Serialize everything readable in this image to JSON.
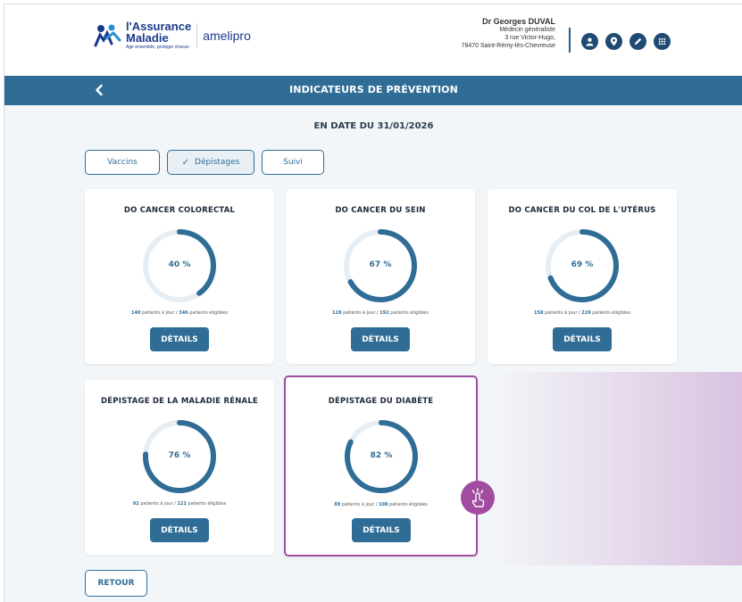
{
  "header": {
    "logo": {
      "line1": "l'Assurance",
      "line2": "Maladie",
      "tagline": "Agir ensemble, protéger chacun",
      "product": "amelipro"
    },
    "doctor": {
      "name": "Dr Georges DUVAL",
      "specialty": "Médecin généraliste",
      "address1": "3 rue Victor-Hugo,",
      "address2": "78470 Saint-Rémy-lès-Chevreuse"
    },
    "icons": [
      "user-icon",
      "location-icon",
      "edit-icon",
      "grid-icon"
    ]
  },
  "titlebar": {
    "back_icon": "chevron-left-icon",
    "title": "INDICATEURS DE PRÉVENTION"
  },
  "date_label": "EN DATE DU 31/01/2026",
  "tabs": [
    {
      "label": "Vaccins",
      "active": false
    },
    {
      "label": "Dépistages",
      "active": true,
      "check": "✓"
    },
    {
      "label": "Suivi",
      "active": false
    }
  ],
  "cards": [
    {
      "title": "DO CANCER COLORECTAL",
      "percent_label": "40 %",
      "percent": 40,
      "patients_ok": "140",
      "patients_ok_suffix": " patients à jour / ",
      "patients_total": "346",
      "patients_total_suffix": " patients éligibles",
      "button": "DÉTAILS"
    },
    {
      "title": "DO CANCER DU SEIN",
      "percent_label": "67 %",
      "percent": 67,
      "patients_ok": "128",
      "patients_ok_suffix": " patients à jour / ",
      "patients_total": "192",
      "patients_total_suffix": " patients éligibles",
      "button": "DÉTAILS"
    },
    {
      "title": "DO CANCER DU COL DE L'UTÉRUS",
      "percent_label": "69 %",
      "percent": 69,
      "patients_ok": "158",
      "patients_ok_suffix": " patients à jour / ",
      "patients_total": "229",
      "patients_total_suffix": " patients éligibles",
      "button": "DÉTAILS"
    },
    {
      "title": "DÉPISTAGE DE LA MALADIE RÉNALE",
      "percent_label": "76 %",
      "percent": 76,
      "patients_ok": "92",
      "patients_ok_suffix": " patients à jour / ",
      "patients_total": "121",
      "patients_total_suffix": " patients éligibles",
      "button": "DÉTAILS"
    },
    {
      "title": "DÉPISTAGE DU DIABÈTE",
      "percent_label": "82 %",
      "percent": 82,
      "patients_ok": "89",
      "patients_ok_suffix": " patients à jour / ",
      "patients_total": "108",
      "patients_total_suffix": " patients éligibles",
      "button": "DÉTAILS"
    }
  ],
  "retour_label": "RETOUR",
  "colors": {
    "primary": "#2f6d96",
    "ring_track": "#e6eef4",
    "highlight": "#a24c9f"
  }
}
